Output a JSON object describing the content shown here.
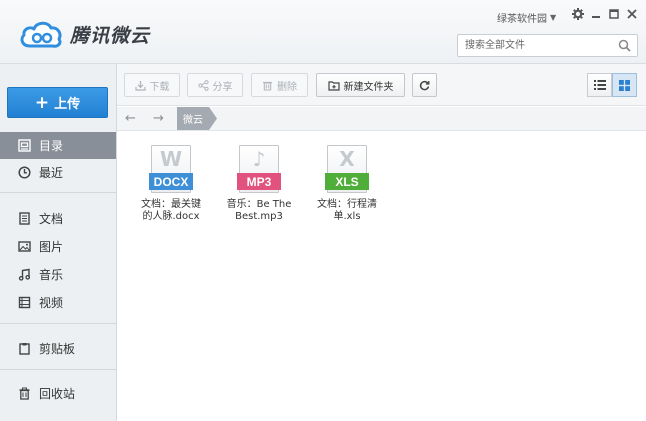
{
  "app": {
    "title": "腾讯微云",
    "user_name": "绿茶软件园",
    "search_placeholder": "搜索全部文件"
  },
  "sidebar": {
    "upload_label": "上传",
    "items": [
      {
        "label": "目录",
        "icon": "folder-icon",
        "active": true
      },
      {
        "label": "最近",
        "icon": "clock-icon",
        "active": false
      },
      {
        "label": "文档",
        "icon": "document-icon",
        "active": false
      },
      {
        "label": "图片",
        "icon": "image-icon",
        "active": false
      },
      {
        "label": "音乐",
        "icon": "music-icon",
        "active": false
      },
      {
        "label": "视频",
        "icon": "film-icon",
        "active": false
      },
      {
        "label": "剪贴板",
        "icon": "clipboard-icon",
        "active": false
      },
      {
        "label": "回收站",
        "icon": "trash-icon",
        "active": false
      }
    ]
  },
  "toolbar": {
    "download_label": "下载",
    "share_label": "分享",
    "delete_label": "删除",
    "new_folder_label": "新建文件夹"
  },
  "breadcrumb": {
    "root": "微云"
  },
  "files": [
    {
      "type_letter": "W",
      "tag": "DOCX",
      "tag_color": "#3d8fd8",
      "name_line1": "文档：最关键",
      "name_line2": "的人脉.docx"
    },
    {
      "type_letter": "♪",
      "tag": "MP3",
      "tag_color": "#e2527e",
      "name_line1": "音乐：Be The",
      "name_line2": "Best.mp3"
    },
    {
      "type_letter": "X",
      "tag": "XLS",
      "tag_color": "#4fae3a",
      "name_line1": "文档：行程清",
      "name_line2": "单.xls"
    }
  ],
  "colors": {
    "accent": "#2a8ad9",
    "sidebar_active": "#888f98"
  }
}
